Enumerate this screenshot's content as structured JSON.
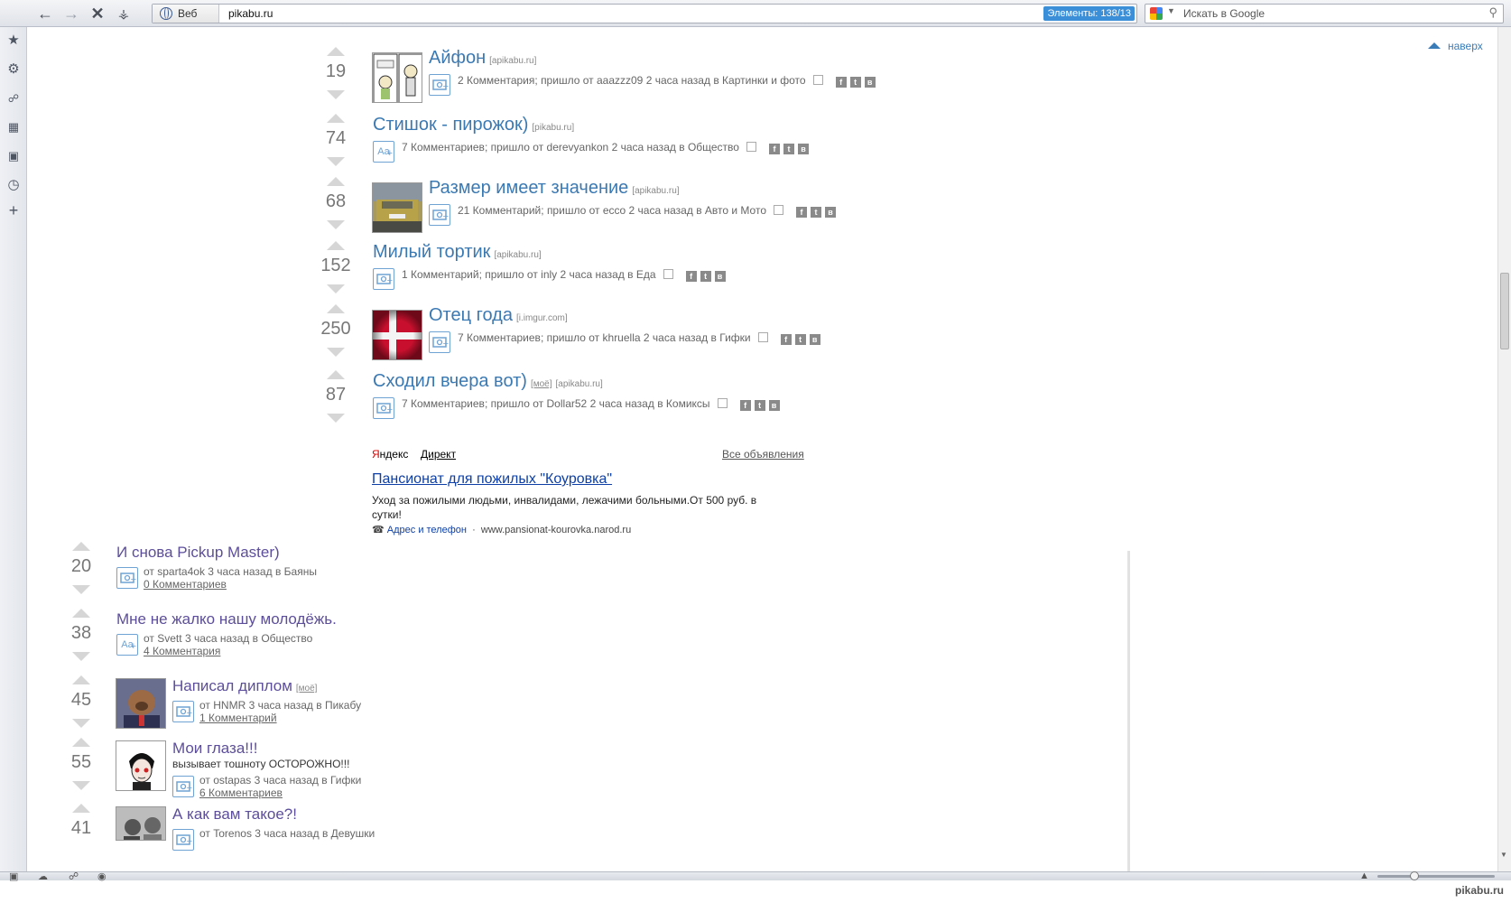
{
  "browser": {
    "web_chip": "Веб",
    "url": "pikabu.ru",
    "elements_badge": "Элементы: 138/13",
    "search_placeholder": "Искать в Google"
  },
  "page": {
    "to_top": "наверх",
    "from": "от",
    "came_from": "пришло от",
    "in": "в"
  },
  "top_posts": [
    {
      "score": "19",
      "title": "Айфон",
      "domain": "[apikabu.ru]",
      "comments": "2 Комментария",
      "author": "aaazzz09",
      "time": "2 часа назад",
      "category": "Картинки и фото",
      "thumb": "comic"
    },
    {
      "score": "74",
      "title": "Стишок - пирожок)",
      "domain": "[pikabu.ru]",
      "comments": "7 Комментариев",
      "author": "derevyankon",
      "time": "2 часа назад",
      "category": "Общество",
      "thumb": "text"
    },
    {
      "score": "68",
      "title": "Размер имеет значение",
      "domain": "[apikabu.ru]",
      "comments": "21 Комментарий",
      "author": "ecco",
      "time": "2 часа назад",
      "category": "Авто и Мото",
      "thumb": "car"
    },
    {
      "score": "152",
      "title": "Милый тортик",
      "domain": "[apikabu.ru]",
      "comments": "1 Комментарий",
      "author": "inly",
      "time": "2 часа назад",
      "category": "Еда",
      "thumb": "none"
    },
    {
      "score": "250",
      "title": "Отец года",
      "domain": "[i.imgur.com]",
      "comments": "7 Комментариев",
      "author": "khruella",
      "time": "2 часа назад",
      "category": "Гифки",
      "thumb": "flag"
    },
    {
      "score": "87",
      "title": "Сходил вчера вот)",
      "mine": "[моё]",
      "domain": "[apikabu.ru]",
      "comments": "7 Комментариев",
      "author": "Dollar52",
      "time": "2 часа назад",
      "category": "Комиксы",
      "thumb": "none"
    }
  ],
  "ad": {
    "yandex": "Яндекс",
    "direct": "Директ",
    "all_ads": "Все объявления",
    "title": "Пансионат для пожилых \"Коуровка\"",
    "body": "Уход за пожилыми людьми, инвалидами, лежачими больными.От 500 руб. в сутки!",
    "address_link": "Адрес и телефон",
    "site": "www.pansionat-kourovka.narod.ru"
  },
  "bottom_posts": [
    {
      "score": "20",
      "title": "И снова Pickup Master)",
      "author": "sparta4ok",
      "time": "3 часа назад",
      "category": "Баяны",
      "comments": "0 Комментариев",
      "thumb": "none",
      "icon": "photo"
    },
    {
      "score": "38",
      "title": "Мне не жалко нашу молодёжь.",
      "author": "Svett",
      "time": "3 часа назад",
      "category": "Общество",
      "comments": "4 Комментария",
      "thumb": "none",
      "icon": "text"
    },
    {
      "score": "45",
      "title": "Написал диплом",
      "mine": "[моё]",
      "author": "HNMR",
      "time": "3 часа назад",
      "category": "Пикабу",
      "comments": "1 Комментарий",
      "thumb": "alf",
      "icon": "photo"
    },
    {
      "score": "55",
      "title": "Мои глаза!!!",
      "subtitle": "вызывает тошноту ОСТОРОЖНО!!!",
      "author": "ostapas",
      "time": "3 часа назад",
      "category": "Гифки",
      "comments": "6 Комментариев",
      "thumb": "face",
      "icon": "photo"
    },
    {
      "score": "41",
      "title": "А как вам такое?!",
      "author": "Torenos",
      "time": "3 часа назад",
      "category": "Девушки",
      "comments": "",
      "thumb": "photo",
      "icon": "photo"
    }
  ],
  "statusbar": {
    "watermark": "pikabu.ru"
  }
}
